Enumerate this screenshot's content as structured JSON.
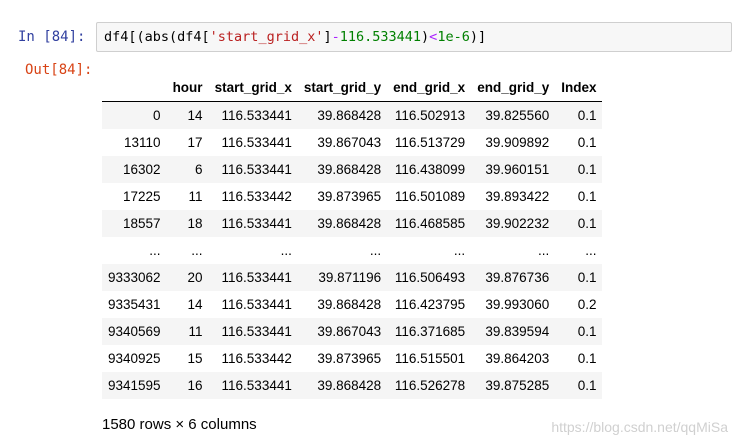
{
  "cell": {
    "in_prompt": "In  [84]:",
    "out_prompt": "Out[84]:",
    "code": {
      "p1": "df4[(abs(df4[",
      "s1": "'start_grid_x'",
      "p2": "]",
      "op1": "-",
      "n1": "116.533441",
      "p3": ")",
      "op2": "<",
      "n2": "1e-6",
      "p4": ")]"
    }
  },
  "table": {
    "columns": [
      "",
      "hour",
      "start_grid_x",
      "start_grid_y",
      "end_grid_x",
      "end_grid_y",
      "Index"
    ],
    "rows": [
      [
        "0",
        "14",
        "116.533441",
        "39.868428",
        "116.502913",
        "39.825560",
        "0.1"
      ],
      [
        "13110",
        "17",
        "116.533441",
        "39.867043",
        "116.513729",
        "39.909892",
        "0.1"
      ],
      [
        "16302",
        "6",
        "116.533441",
        "39.868428",
        "116.438099",
        "39.960151",
        "0.1"
      ],
      [
        "17225",
        "11",
        "116.533442",
        "39.873965",
        "116.501089",
        "39.893422",
        "0.1"
      ],
      [
        "18557",
        "18",
        "116.533441",
        "39.868428",
        "116.468585",
        "39.902232",
        "0.1"
      ],
      [
        "...",
        "...",
        "...",
        "...",
        "...",
        "...",
        "..."
      ],
      [
        "9333062",
        "20",
        "116.533441",
        "39.871196",
        "116.506493",
        "39.876736",
        "0.1"
      ],
      [
        "9335431",
        "14",
        "116.533441",
        "39.868428",
        "116.423795",
        "39.993060",
        "0.2"
      ],
      [
        "9340569",
        "11",
        "116.533441",
        "39.867043",
        "116.371685",
        "39.839594",
        "0.1"
      ],
      [
        "9340925",
        "15",
        "116.533442",
        "39.873965",
        "116.515501",
        "39.864203",
        "0.1"
      ],
      [
        "9341595",
        "16",
        "116.533441",
        "39.868428",
        "116.526278",
        "39.875285",
        "0.1"
      ]
    ],
    "shape": "1580 rows × 6 columns"
  },
  "watermark": "https://blog.csdn.net/qqMiSa"
}
